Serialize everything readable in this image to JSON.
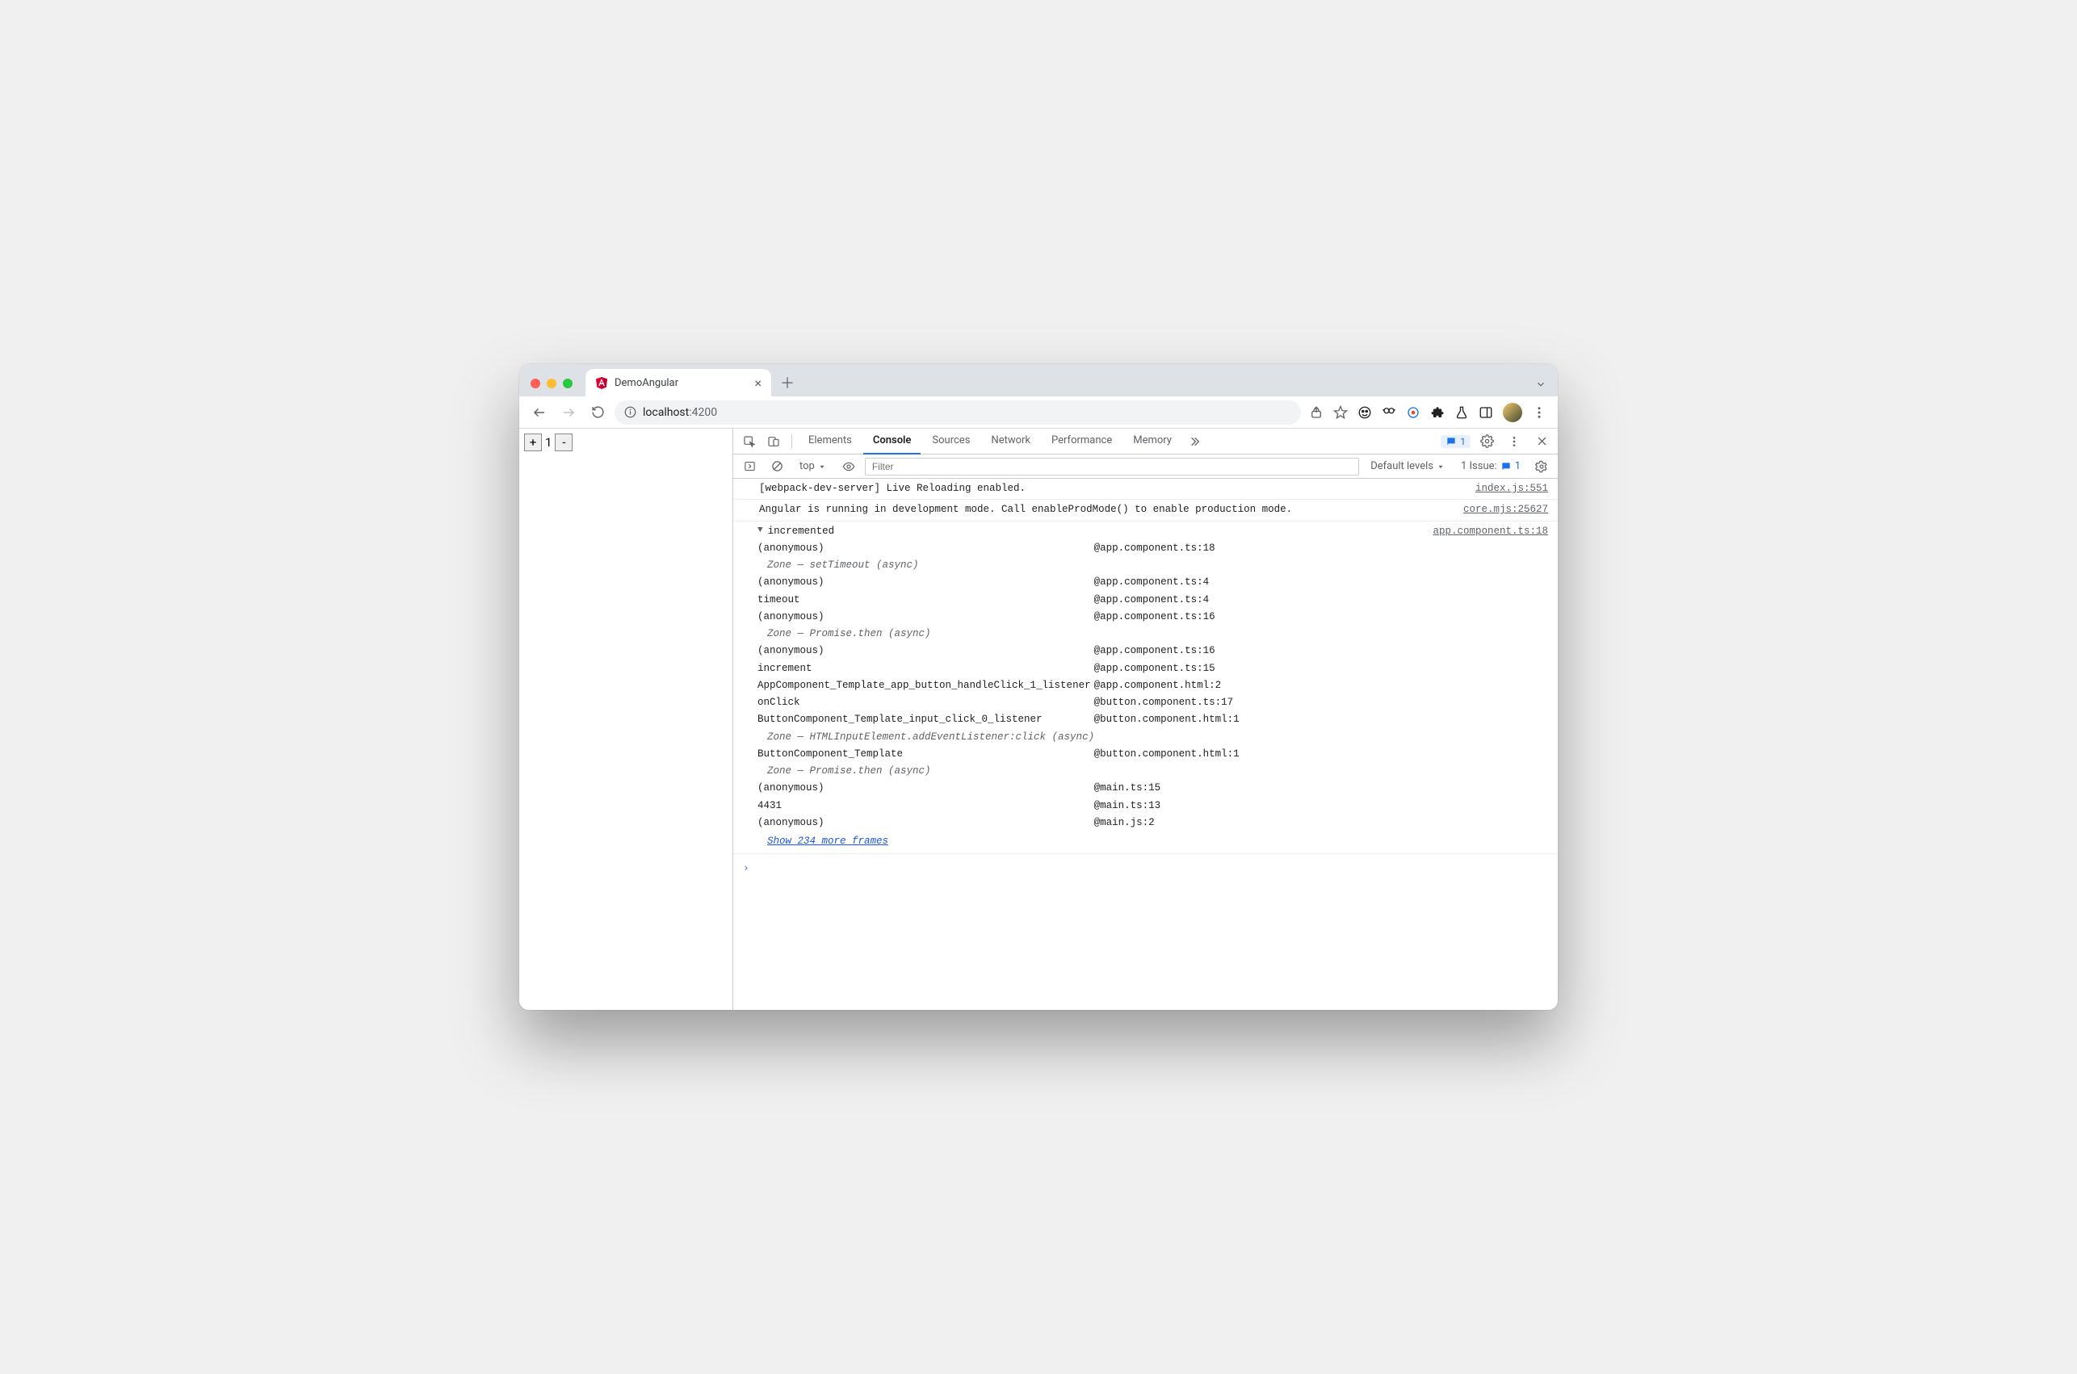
{
  "browser": {
    "tab_title": "DemoAngular",
    "url_host": "localhost",
    "url_port": ":4200"
  },
  "page": {
    "plus": "+",
    "minus": "-",
    "count": "1"
  },
  "devtools": {
    "tabs": [
      "Elements",
      "Console",
      "Sources",
      "Network",
      "Performance",
      "Memory"
    ],
    "active_tab": 1,
    "messages_badge": "1",
    "filter_placeholder": "Filter",
    "context": "top",
    "levels": "Default levels",
    "issues_label": "1 Issue:",
    "issues_count": "1",
    "prompt": "›"
  },
  "log": [
    {
      "text": "[webpack-dev-server] Live Reloading enabled.",
      "src": "index.js:551"
    },
    {
      "text": "Angular is running in development mode. Call enableProdMode() to enable production mode.",
      "src": "core.mjs:25627"
    }
  ],
  "trace": {
    "label": "incremented",
    "src": "app.component.ts:18",
    "frames": [
      {
        "fn": "(anonymous)",
        "loc": "app.component.ts:18"
      },
      {
        "zone": "Zone — setTimeout (async)"
      },
      {
        "fn": "(anonymous)",
        "loc": "app.component.ts:4"
      },
      {
        "fn": "timeout",
        "loc": "app.component.ts:4"
      },
      {
        "fn": "(anonymous)",
        "loc": "app.component.ts:16"
      },
      {
        "zone": "Zone — Promise.then (async)"
      },
      {
        "fn": "(anonymous)",
        "loc": "app.component.ts:16"
      },
      {
        "fn": "increment",
        "loc": "app.component.ts:15"
      },
      {
        "fn": "AppComponent_Template_app_button_handleClick_1_listener",
        "loc": "app.component.html:2"
      },
      {
        "fn": "onClick",
        "loc": "button.component.ts:17"
      },
      {
        "fn": "ButtonComponent_Template_input_click_0_listener",
        "loc": "button.component.html:1"
      },
      {
        "zone": "Zone — HTMLInputElement.addEventListener:click (async)"
      },
      {
        "fn": "ButtonComponent_Template",
        "loc": "button.component.html:1"
      },
      {
        "zone": "Zone — Promise.then (async)"
      },
      {
        "fn": "(anonymous)",
        "loc": "main.ts:15"
      },
      {
        "fn": "4431",
        "loc": "main.ts:13"
      },
      {
        "fn": "(anonymous)",
        "loc": "main.js:2"
      }
    ],
    "more": "Show 234 more frames"
  }
}
